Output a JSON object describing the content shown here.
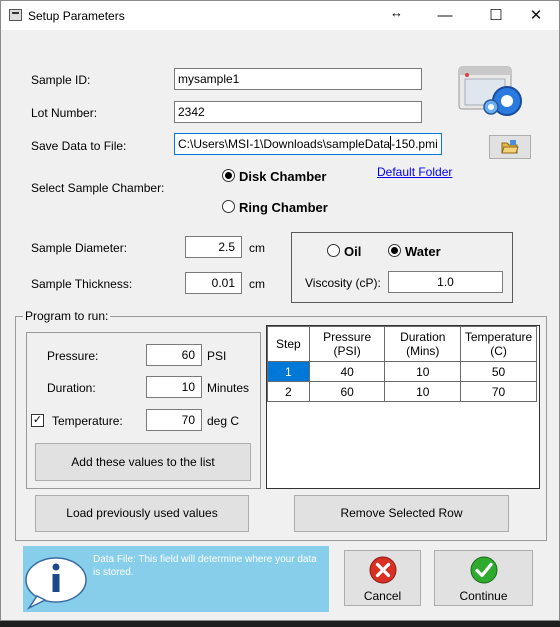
{
  "window": {
    "title": "Setup Parameters",
    "minimize": "—",
    "maximize": "☐",
    "close": "✕",
    "resize_glyph": "↔"
  },
  "sample": {
    "id_label": "Sample ID:",
    "id_value": "mysample1",
    "lot_label": "Lot Number:",
    "lot_value": "2342",
    "save_label": "Save Data to File:",
    "save_value_a": "C:\\Users\\MSI-1\\Downloads\\sampleData",
    "save_value_b": "-150.pmi",
    "default_folder": "Default Folder"
  },
  "chamber": {
    "label": "Select Sample Chamber:",
    "options": [
      "Disk Chamber",
      "Ring Chamber"
    ],
    "selected": "Disk Chamber"
  },
  "dimensions": {
    "diameter_label": "Sample Diameter:",
    "diameter_value": "2.5",
    "diameter_unit": "cm",
    "thickness_label": "Sample Thickness:",
    "thickness_value": "0.01",
    "thickness_unit": "cm"
  },
  "fluid": {
    "options": [
      "Oil",
      "Water"
    ],
    "selected": "Water",
    "viscosity_label": "Viscosity (cP):",
    "viscosity_value": "1.0"
  },
  "program": {
    "label": "Program to run:",
    "pressure_label": "Pressure:",
    "pressure_value": "60",
    "pressure_unit": "PSI",
    "duration_label": "Duration:",
    "duration_value": "10",
    "duration_unit": "Minutes",
    "temperature_label": "Temperature:",
    "temperature_value": "70",
    "temperature_unit": "deg C",
    "temperature_checked": "✓",
    "add_button": "Add these values to the list",
    "load_button": "Load previously used values",
    "remove_button": "Remove Selected Row"
  },
  "table": {
    "headers": [
      "Step",
      "Pressure\n(PSI)",
      "Duration\n(Mins)",
      "Temperature\n(C)"
    ],
    "rows": [
      [
        "1",
        "40",
        "10",
        "50"
      ],
      [
        "2",
        "60",
        "10",
        "70"
      ]
    ],
    "selected_row": 0
  },
  "info": {
    "text": "Data File: This field will determine where your data is stored."
  },
  "actions": {
    "cancel": "Cancel",
    "continue": "Continue"
  },
  "colors": {
    "accent": "#0078d7",
    "info_bg": "#87ceeb",
    "cancel_red": "#d93025",
    "continue_green": "#2eaa2e"
  }
}
